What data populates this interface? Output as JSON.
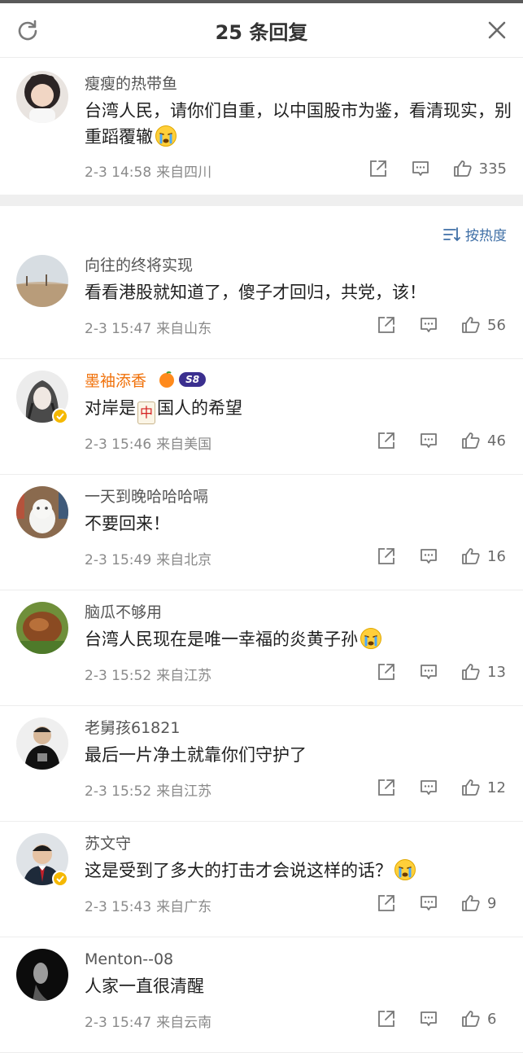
{
  "header": {
    "title": "25 条回复",
    "refresh_icon": "refresh-icon",
    "close_icon": "close-icon"
  },
  "top_comment": {
    "username": "瘦瘦的热带鱼",
    "text": "台湾人民，请你们自重，以中国股市为鉴，看清现实，别重蹈覆辙",
    "date": "2-3 14:58",
    "location": "来自四川",
    "likes": "335"
  },
  "sort": {
    "label": "按热度"
  },
  "replies": [
    {
      "username": "向往的终将实现",
      "text": "看看港股就知道了，傻子才回归，共党，该！",
      "date": "2-3 15:47",
      "location": "来自山东",
      "likes": "56"
    },
    {
      "username": "墨袖添香",
      "text_before": "对岸是",
      "tile": "中",
      "text_after": "国人的希望",
      "badge": "S8",
      "date": "2-3 15:46",
      "location": "来自美国",
      "likes": "46"
    },
    {
      "username": "一天到晚哈哈哈嗝",
      "text": "不要回来！",
      "date": "2-3 15:49",
      "location": "来自北京",
      "likes": "16"
    },
    {
      "username": "脑瓜不够用",
      "text": "台湾人民现在是唯一幸福的炎黄子孙",
      "date": "2-3 15:52",
      "location": "来自江苏",
      "likes": "13"
    },
    {
      "username": "老舅孩61821",
      "text": "最后一片净土就靠你们守护了",
      "date": "2-3 15:52",
      "location": "来自江苏",
      "likes": "12"
    },
    {
      "username": "苏文守",
      "text": "这是受到了多大的打击才会说这样的话？",
      "date": "2-3 15:43",
      "location": "来自广东",
      "likes": "9"
    },
    {
      "username": "Menton--08",
      "text": "人家一直很清醒",
      "date": "2-3 15:47",
      "location": "来自云南",
      "likes": "6"
    }
  ],
  "colors": {
    "accent_blue": "#3f6fa6",
    "name_orange": "#f0710a",
    "verified_gold": "#f5b800"
  }
}
